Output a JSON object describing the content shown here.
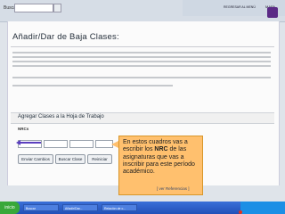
{
  "topbar": {
    "search_label": "Buscar",
    "search_placeholder": "",
    "regresar_label": "REGRESAR AL MENÚ",
    "mapa_label": "MAPA"
  },
  "page": {
    "title": "Añadir/Dar de Baja Clases:",
    "form_title": "Agregar Clases a la Hoja de Trabajo",
    "nrcs_label": "NRCs",
    "buttons": [
      "Enviar Cambios",
      "Buscar Clase",
      "Reiniciar"
    ],
    "footer_link": "[ ver Referencias ]"
  },
  "callout": {
    "text_before": "En estos cuadros vas a escribir los ",
    "text_bold": "NRC",
    "text_after": " de las asignaturas que vas a inscribir para este período académico."
  },
  "taskbar": {
    "start_label": "inicio",
    "tasks": [
      "Buscar",
      "Añadir/Dar...",
      "Relación de c..."
    ]
  },
  "colors": {
    "callout_bg": "#ffc06e",
    "arrow": "#5b3fbf",
    "taskbar": "#2a5fcc"
  }
}
